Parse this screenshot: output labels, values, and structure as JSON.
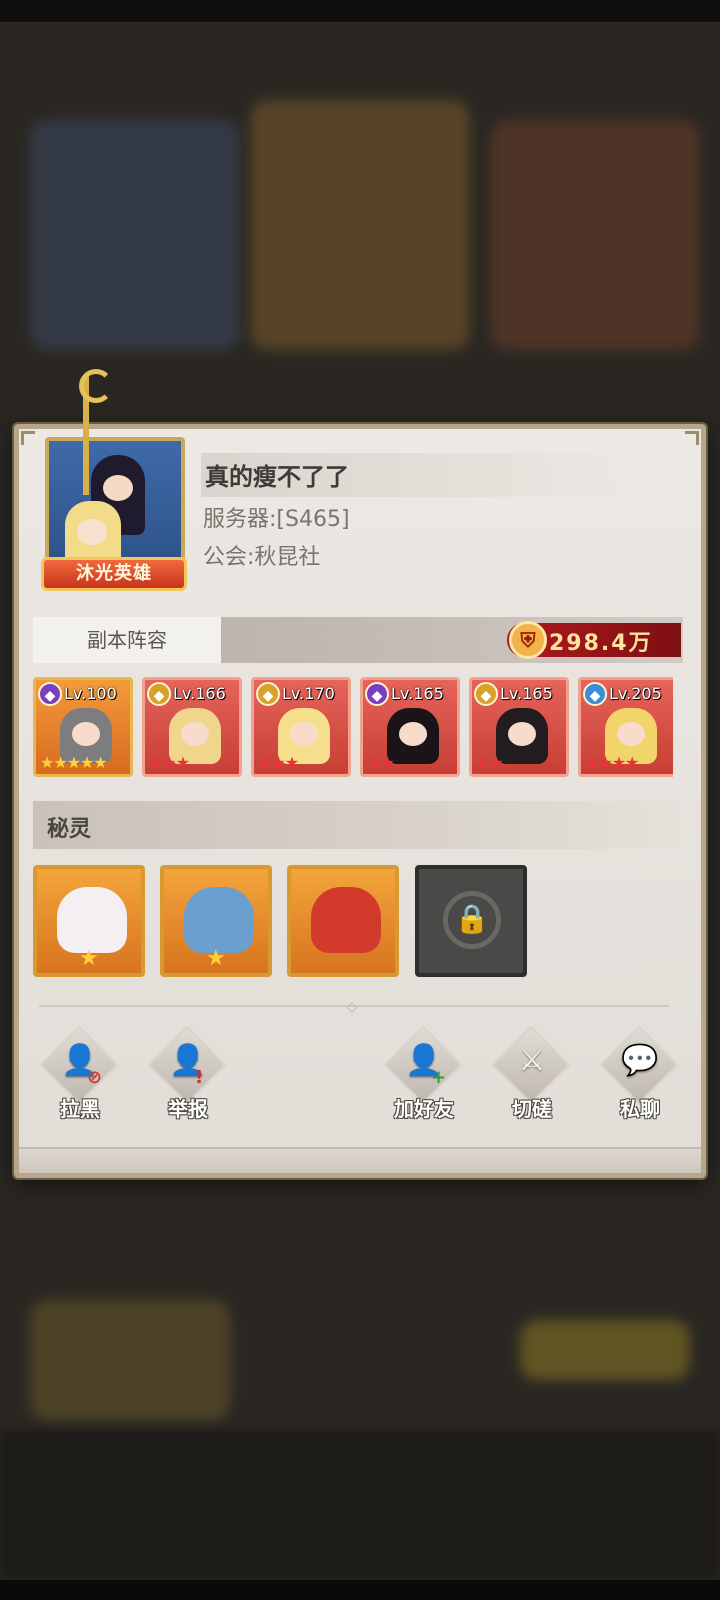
{
  "profile": {
    "name": "真的瘦不了了",
    "server": "服务器:[S465]",
    "guild": "公会:秋昆社",
    "badge": "沐光英雄"
  },
  "lineup": {
    "tab_label": "副本阵容",
    "power": "298.4万",
    "heroes": [
      {
        "level": "Lv.100",
        "faction_color": "#7a3fbf",
        "faction_icon": "purple-faction-icon",
        "frame": "orange",
        "stars": "★★★★★",
        "star_color": "gold",
        "body_color": "#7d7d7f"
      },
      {
        "level": "Lv.166",
        "faction_color": "#d8a12a",
        "faction_icon": "gold-faction-icon",
        "frame": "red",
        "stars": "★★★",
        "star_color": "red",
        "body_color": "#f0d68a"
      },
      {
        "level": "Lv.170",
        "faction_color": "#d8a12a",
        "faction_icon": "gold-faction-icon",
        "frame": "red",
        "stars": "★★★",
        "star_color": "red",
        "body_color": "#f5df8c"
      },
      {
        "level": "Lv.165",
        "faction_color": "#7a3fbf",
        "faction_icon": "purple-faction-icon",
        "frame": "red",
        "stars": "★★",
        "star_color": "red",
        "body_color": "#1a1418"
      },
      {
        "level": "Lv.165",
        "faction_color": "#d8a12a",
        "faction_icon": "gold-faction-icon",
        "frame": "red",
        "stars": "★★",
        "star_color": "red",
        "body_color": "#221b1f"
      },
      {
        "level": "Lv.205",
        "faction_color": "#3a8ed8",
        "faction_icon": "blue-faction-icon",
        "frame": "red",
        "stars": "★★★★",
        "star_color": "red",
        "body_color": "#f2d56a"
      }
    ]
  },
  "spirits": {
    "title": "秘灵",
    "items": [
      {
        "name_icon": "white-rabbit-spirit-icon",
        "color": "#f4eff2",
        "stars": "★"
      },
      {
        "name_icon": "blue-unicorn-spirit-icon",
        "color": "#6a9fd0",
        "stars": "★"
      },
      {
        "name_icon": "red-dragon-spirit-icon",
        "color": "#d23a2c",
        "stars": ""
      }
    ],
    "locked_icon": "lock-icon"
  },
  "actions": [
    {
      "id": "block",
      "label": "拉黑",
      "icon": "block-user-icon",
      "glyph": "👤",
      "sub": "⊘",
      "sub_color": "#d03a2f"
    },
    {
      "id": "report",
      "label": "举报",
      "icon": "report-user-icon",
      "glyph": "👤",
      "sub": "!",
      "sub_color": "#c3322a"
    },
    {
      "id": "add-friend",
      "label": "加好友",
      "icon": "add-friend-icon",
      "glyph": "👤",
      "sub": "+",
      "sub_color": "#2f9a3a"
    },
    {
      "id": "duel",
      "label": "切磋",
      "icon": "crossed-swords-icon",
      "glyph": "⚔",
      "sub": "",
      "sub_color": "#000000"
    },
    {
      "id": "chat",
      "label": "私聊",
      "icon": "chat-bubble-icon",
      "glyph": "💬",
      "sub": "",
      "sub_color": "#000000"
    }
  ]
}
